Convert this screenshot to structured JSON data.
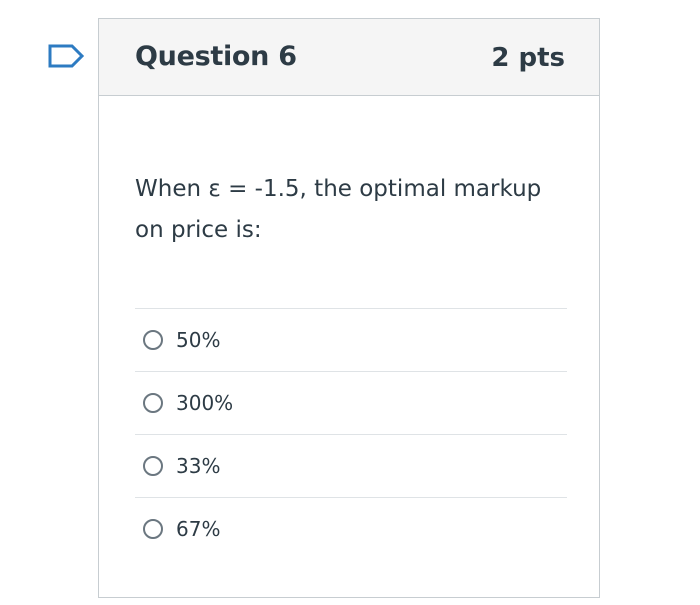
{
  "icons": {
    "flag": "flag-outline-icon",
    "radio": "radio-unchecked-icon"
  },
  "colors": {
    "flag_stroke": "#2d7bc2",
    "text": "#2d3b45",
    "header_bg": "#f5f5f5",
    "border": "#c7cdd1"
  },
  "question": {
    "title": "Question 6",
    "points": "2 pts",
    "text": "When ε = -1.5, the optimal markup on price is:",
    "answers": [
      {
        "label": "50%",
        "selected": false
      },
      {
        "label": "300%",
        "selected": false
      },
      {
        "label": "33%",
        "selected": false
      },
      {
        "label": "67%",
        "selected": false
      }
    ]
  }
}
